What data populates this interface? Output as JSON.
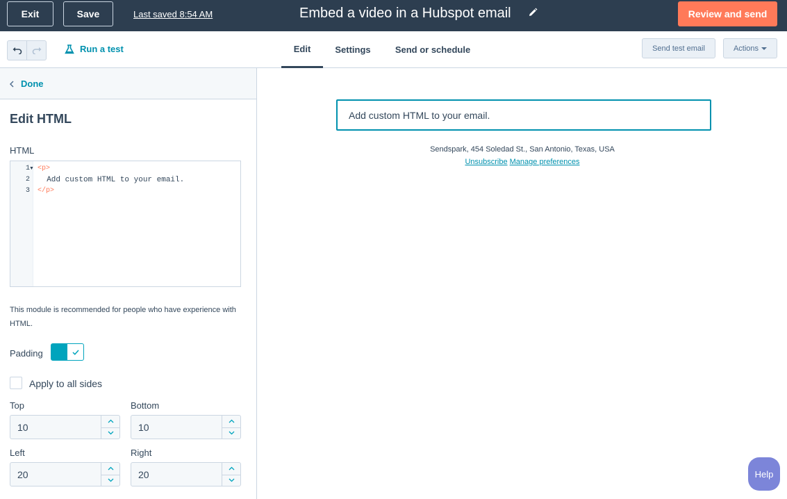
{
  "topbar": {
    "exit_label": "Exit",
    "save_label": "Save",
    "last_saved": "Last saved 8:54 AM",
    "title": "Embed a video in a Hubspot email",
    "review_label": "Review and send"
  },
  "toolbar": {
    "run_test_label": "Run a test",
    "tabs": [
      {
        "label": "Edit",
        "active": true
      },
      {
        "label": "Settings",
        "active": false
      },
      {
        "label": "Send or schedule",
        "active": false
      }
    ],
    "send_test_label": "Send test email",
    "actions_label": "Actions"
  },
  "panel": {
    "done_label": "Done",
    "title": "Edit HTML",
    "html_label": "HTML",
    "code": {
      "line_numbers": [
        "1",
        "2",
        "3"
      ],
      "lines": [
        "<p>",
        "  Add custom HTML to your email.",
        "</p>"
      ]
    },
    "note": "This module is recommended for people who have experience with HTML.",
    "padding_label": "Padding",
    "padding_enabled": true,
    "apply_all_label": "Apply to all sides",
    "apply_all_checked": false,
    "fields": {
      "top": {
        "label": "Top",
        "value": "10"
      },
      "bottom": {
        "label": "Bottom",
        "value": "10"
      },
      "left": {
        "label": "Left",
        "value": "20"
      },
      "right": {
        "label": "Right",
        "value": "20"
      }
    }
  },
  "preview": {
    "html_block_text": "Add custom HTML to your email.",
    "address": "Sendspark, 454 Soledad St., San Antonio, Texas, USA",
    "unsubscribe": "Unsubscribe",
    "manage_prefs": "Manage preferences"
  },
  "help_label": "Help",
  "colors": {
    "topbar_bg": "#2d3e50",
    "accent_orange": "#ff7a59",
    "link_teal": "#0091ae",
    "toggle_teal": "#00a4bd",
    "help_purple": "#7c85d9"
  }
}
